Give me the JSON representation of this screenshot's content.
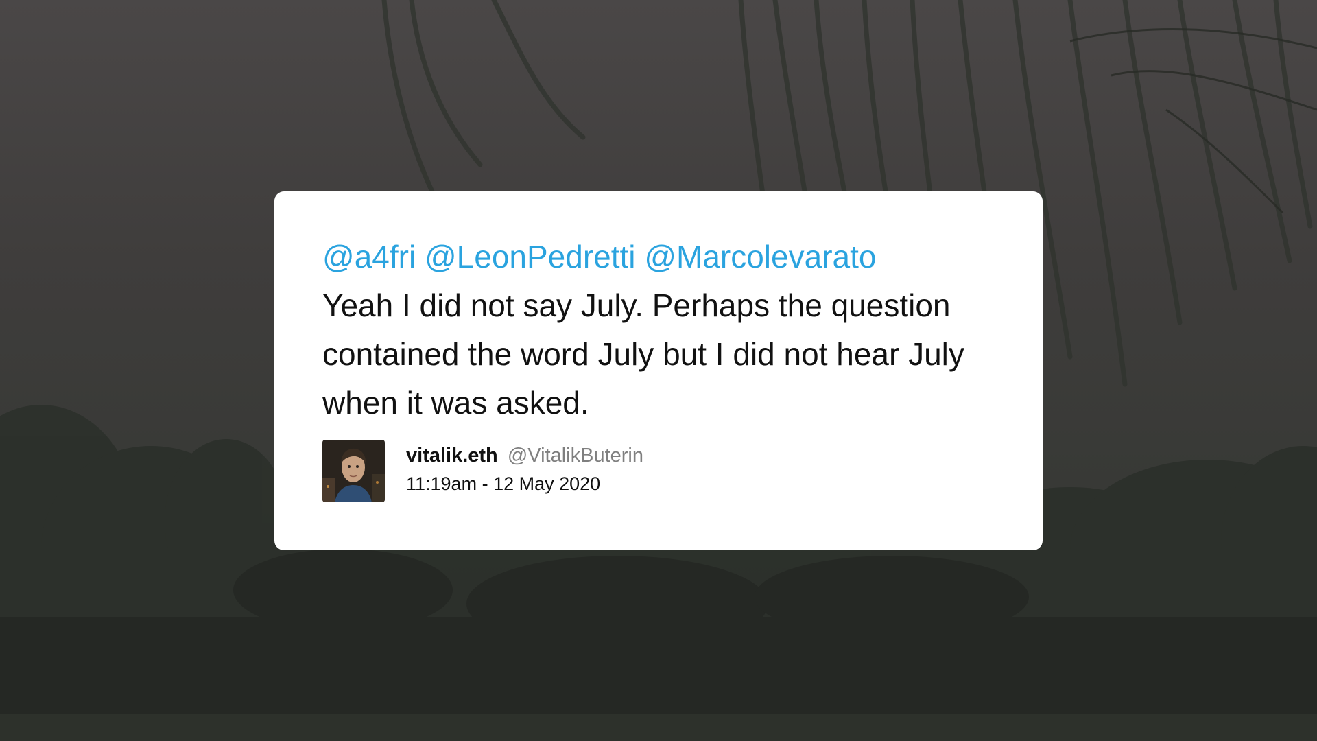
{
  "tweet": {
    "mentions": [
      "@a4fri",
      "@LeonPedretti",
      "@Marcolevarato"
    ],
    "body": "Yeah I did not say July. Perhaps the question contained the word July but I did not hear July when it was asked.",
    "author": {
      "display_name": "vitalik.eth",
      "handle": "@VitalikButerin",
      "avatar_icon": "profile-photo"
    },
    "timestamp": "11:19am - 12 May 2020"
  },
  "colors": {
    "mention": "#2aa3df",
    "text": "#111111",
    "handle": "#7f7f7f",
    "card": "#ffffff",
    "background": "#3f3d3c"
  }
}
